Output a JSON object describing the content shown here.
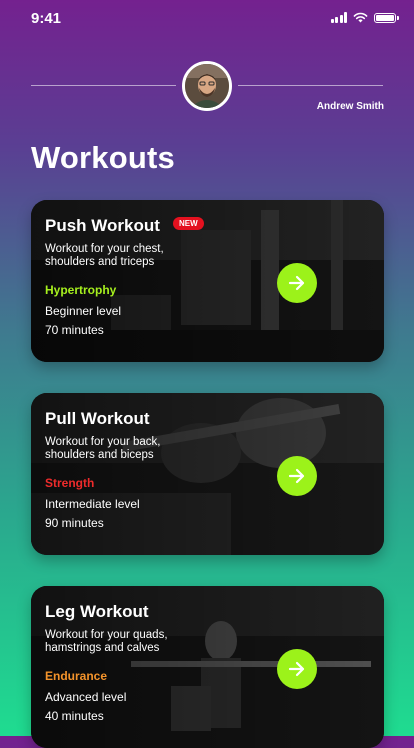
{
  "status_bar": {
    "time": "9:41"
  },
  "header": {
    "user_name": "Andrew Smith",
    "avatar_icon": "user-avatar"
  },
  "page": {
    "title": "Workouts"
  },
  "colors": {
    "accent": "#9cf21a",
    "badge": "#e4111f",
    "hypertrophy": "#a6f01e",
    "strength": "#ee2b2b",
    "endurance": "#f3932b"
  },
  "workouts": [
    {
      "title": "Push Workout",
      "badge": "NEW",
      "description": "Workout for your chest, shoulders and triceps",
      "category": "Hypertrophy",
      "level": "Beginner level",
      "duration": "70 minutes"
    },
    {
      "title": "Pull Workout",
      "badge": "",
      "description": "Workout for your back, shoulders and biceps",
      "category": "Strength",
      "level": "Intermediate level",
      "duration": "90 minutes"
    },
    {
      "title": "Leg Workout",
      "badge": "",
      "description": "Workout for your quads, hamstrings and calves",
      "category": "Endurance",
      "level": "Advanced level",
      "duration": "40 minutes"
    }
  ]
}
